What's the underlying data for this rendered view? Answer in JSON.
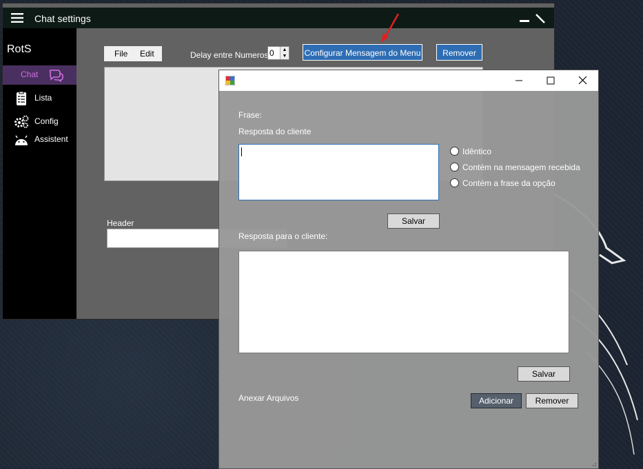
{
  "main_window": {
    "title": "Chat settings",
    "brand": "RotS",
    "sidebar": [
      {
        "label": "Chat",
        "icon": "chat-bubbles-icon",
        "active": true
      },
      {
        "label": "Lista",
        "icon": "clipboard-list-icon"
      },
      {
        "label": "Config",
        "icon": "gears-icon"
      },
      {
        "label": "Assistent",
        "icon": "android-icon"
      }
    ],
    "menu": {
      "file": "File",
      "edit": "Edit"
    },
    "delay_label": "Delay entre Numeros:",
    "delay_value": "0",
    "configurar_button": "Configurar Mensagem do Menu",
    "remover_button": "Remover",
    "header_label": "Header"
  },
  "dialog": {
    "frase_label": "Frase:",
    "resposta_cliente_label": "Resposta do cliente",
    "resposta_cliente_value": "",
    "radio_options": [
      "Idêntico",
      "Contém na mensagem recebida",
      "Contém a frase da opção"
    ],
    "salvar1": "Salvar",
    "resposta_para_label": "Resposta para o cliente:",
    "resposta_para_value": "",
    "salvar2": "Salvar",
    "anexar_label": "Anexar Arquivos",
    "adicionar_button": "Adicionar",
    "remover_button": "Remover"
  },
  "colors": {
    "accent_blue": "#2e6db3",
    "sidebar_active": "#d06fe0",
    "arrow": "#e02020"
  }
}
